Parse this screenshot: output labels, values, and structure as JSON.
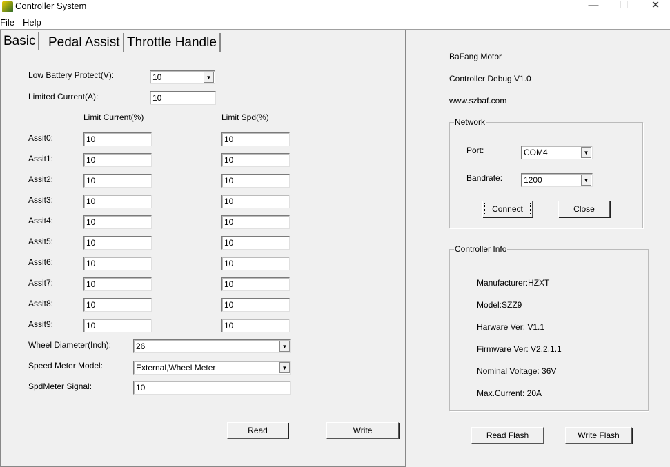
{
  "window": {
    "title": "Controller System",
    "minimize": "—",
    "maximize": "☐",
    "close": "✕"
  },
  "menu": [
    "File",
    "Help"
  ],
  "tabs": [
    "Basic",
    "Pedal Assist",
    "Throttle Handle"
  ],
  "basic": {
    "low_battery_label": "Low Battery Protect(V):",
    "low_battery_value": "10",
    "limited_current_label": "Limited Current(A):",
    "limited_current_value": "10",
    "col_current": "Limit Current(%)",
    "col_speed": "Limit Spd(%)",
    "assists": [
      {
        "label": "Assit0:",
        "current": "10",
        "speed": "10"
      },
      {
        "label": "Assit1:",
        "current": "10",
        "speed": "10"
      },
      {
        "label": "Assit2:",
        "current": "10",
        "speed": "10"
      },
      {
        "label": "Assit3:",
        "current": "10",
        "speed": "10"
      },
      {
        "label": "Assit4:",
        "current": "10",
        "speed": "10"
      },
      {
        "label": "Assit5:",
        "current": "10",
        "speed": "10"
      },
      {
        "label": "Assit6:",
        "current": "10",
        "speed": "10"
      },
      {
        "label": "Assit7:",
        "current": "10",
        "speed": "10"
      },
      {
        "label": "Assit8:",
        "current": "10",
        "speed": "10"
      },
      {
        "label": "Assit9:",
        "current": "10",
        "speed": "10"
      }
    ],
    "wheel_label": "Wheel Diameter(Inch):",
    "wheel_value": "26",
    "speed_meter_label": "Speed Meter Model:",
    "speed_meter_value": "External,Wheel Meter",
    "spd_signal_label": "SpdMeter Signal:",
    "spd_signal_value": "10",
    "read": "Read",
    "write": "Write"
  },
  "info": {
    "brand": "BaFang Motor",
    "version": "Controller Debug V1.0",
    "url": "www.szbaf.com"
  },
  "network": {
    "title": "Network",
    "port_label": "Port:",
    "port_value": "COM4",
    "baud_label": "Bandrate:",
    "baud_value": "1200",
    "connect": "Connect",
    "close": "Close"
  },
  "controller_info": {
    "title": "Controller Info",
    "lines": [
      "Manufacturer:HZXT",
      "Model:SZZ9",
      "Harware Ver: V1.1",
      "Firmware Ver: V2.2.1.1",
      "Nominal Voltage: 36V",
      "Max.Current: 20A"
    ]
  },
  "flash": {
    "read": "Read Flash",
    "write": "Write Flash"
  }
}
